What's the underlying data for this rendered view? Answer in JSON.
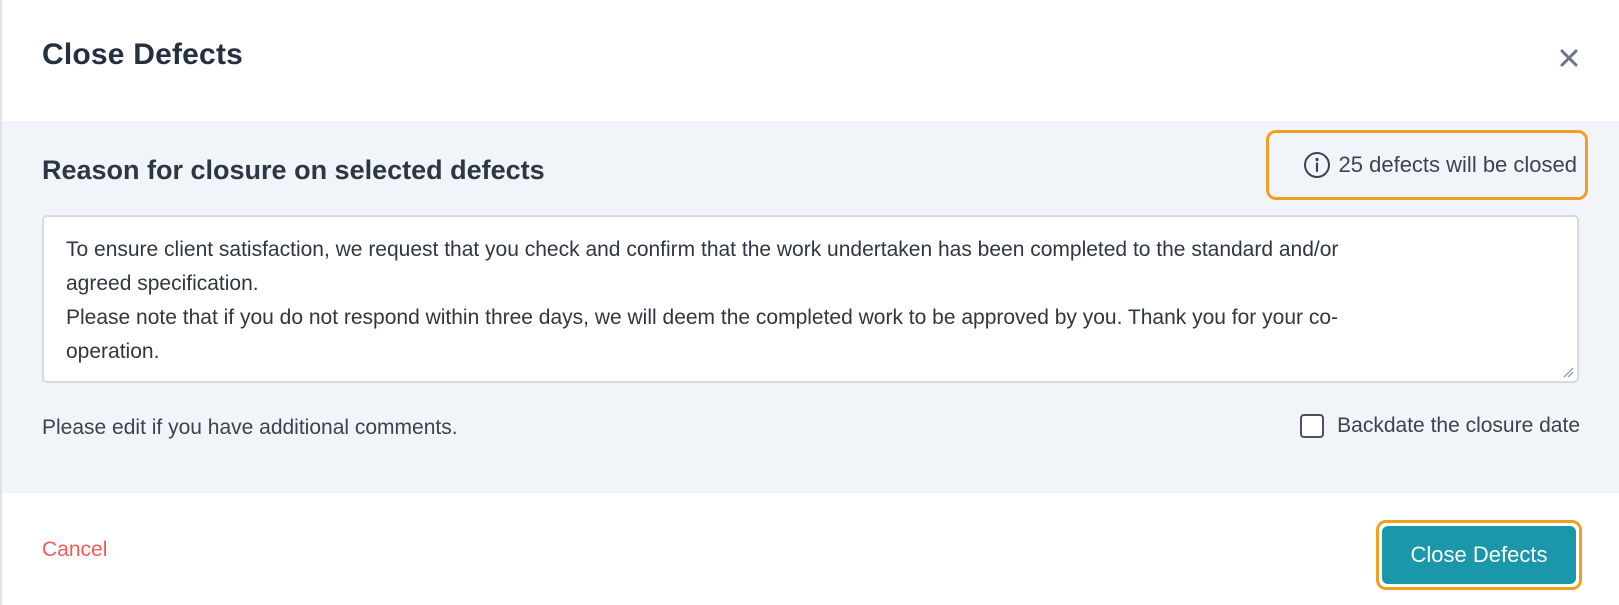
{
  "modal": {
    "title": "Close Defects",
    "close_icon": "close-icon"
  },
  "reason": {
    "title": "Reason for closure on selected defects",
    "count_icon": "info-icon",
    "count_text": "25 defects will be closed",
    "text": "To ensure client satisfaction, we request that you check and confirm that the work undertaken has been completed to the standard and/or\nagreed specification.\nPlease note that if you do not respond within three days, we will deem the completed work to be approved by you. Thank you for your co-\noperation.",
    "hint": "Please edit if you have additional comments.",
    "backdate_label": "Backdate the closure date",
    "backdate_checked": false
  },
  "footer": {
    "cancel_label": "Cancel",
    "confirm_label": "Close Defects"
  },
  "colors": {
    "accent": "#1a97aa",
    "highlight": "#f0a020",
    "cancel": "#f25c54",
    "body_background": "#f1f4f8"
  }
}
